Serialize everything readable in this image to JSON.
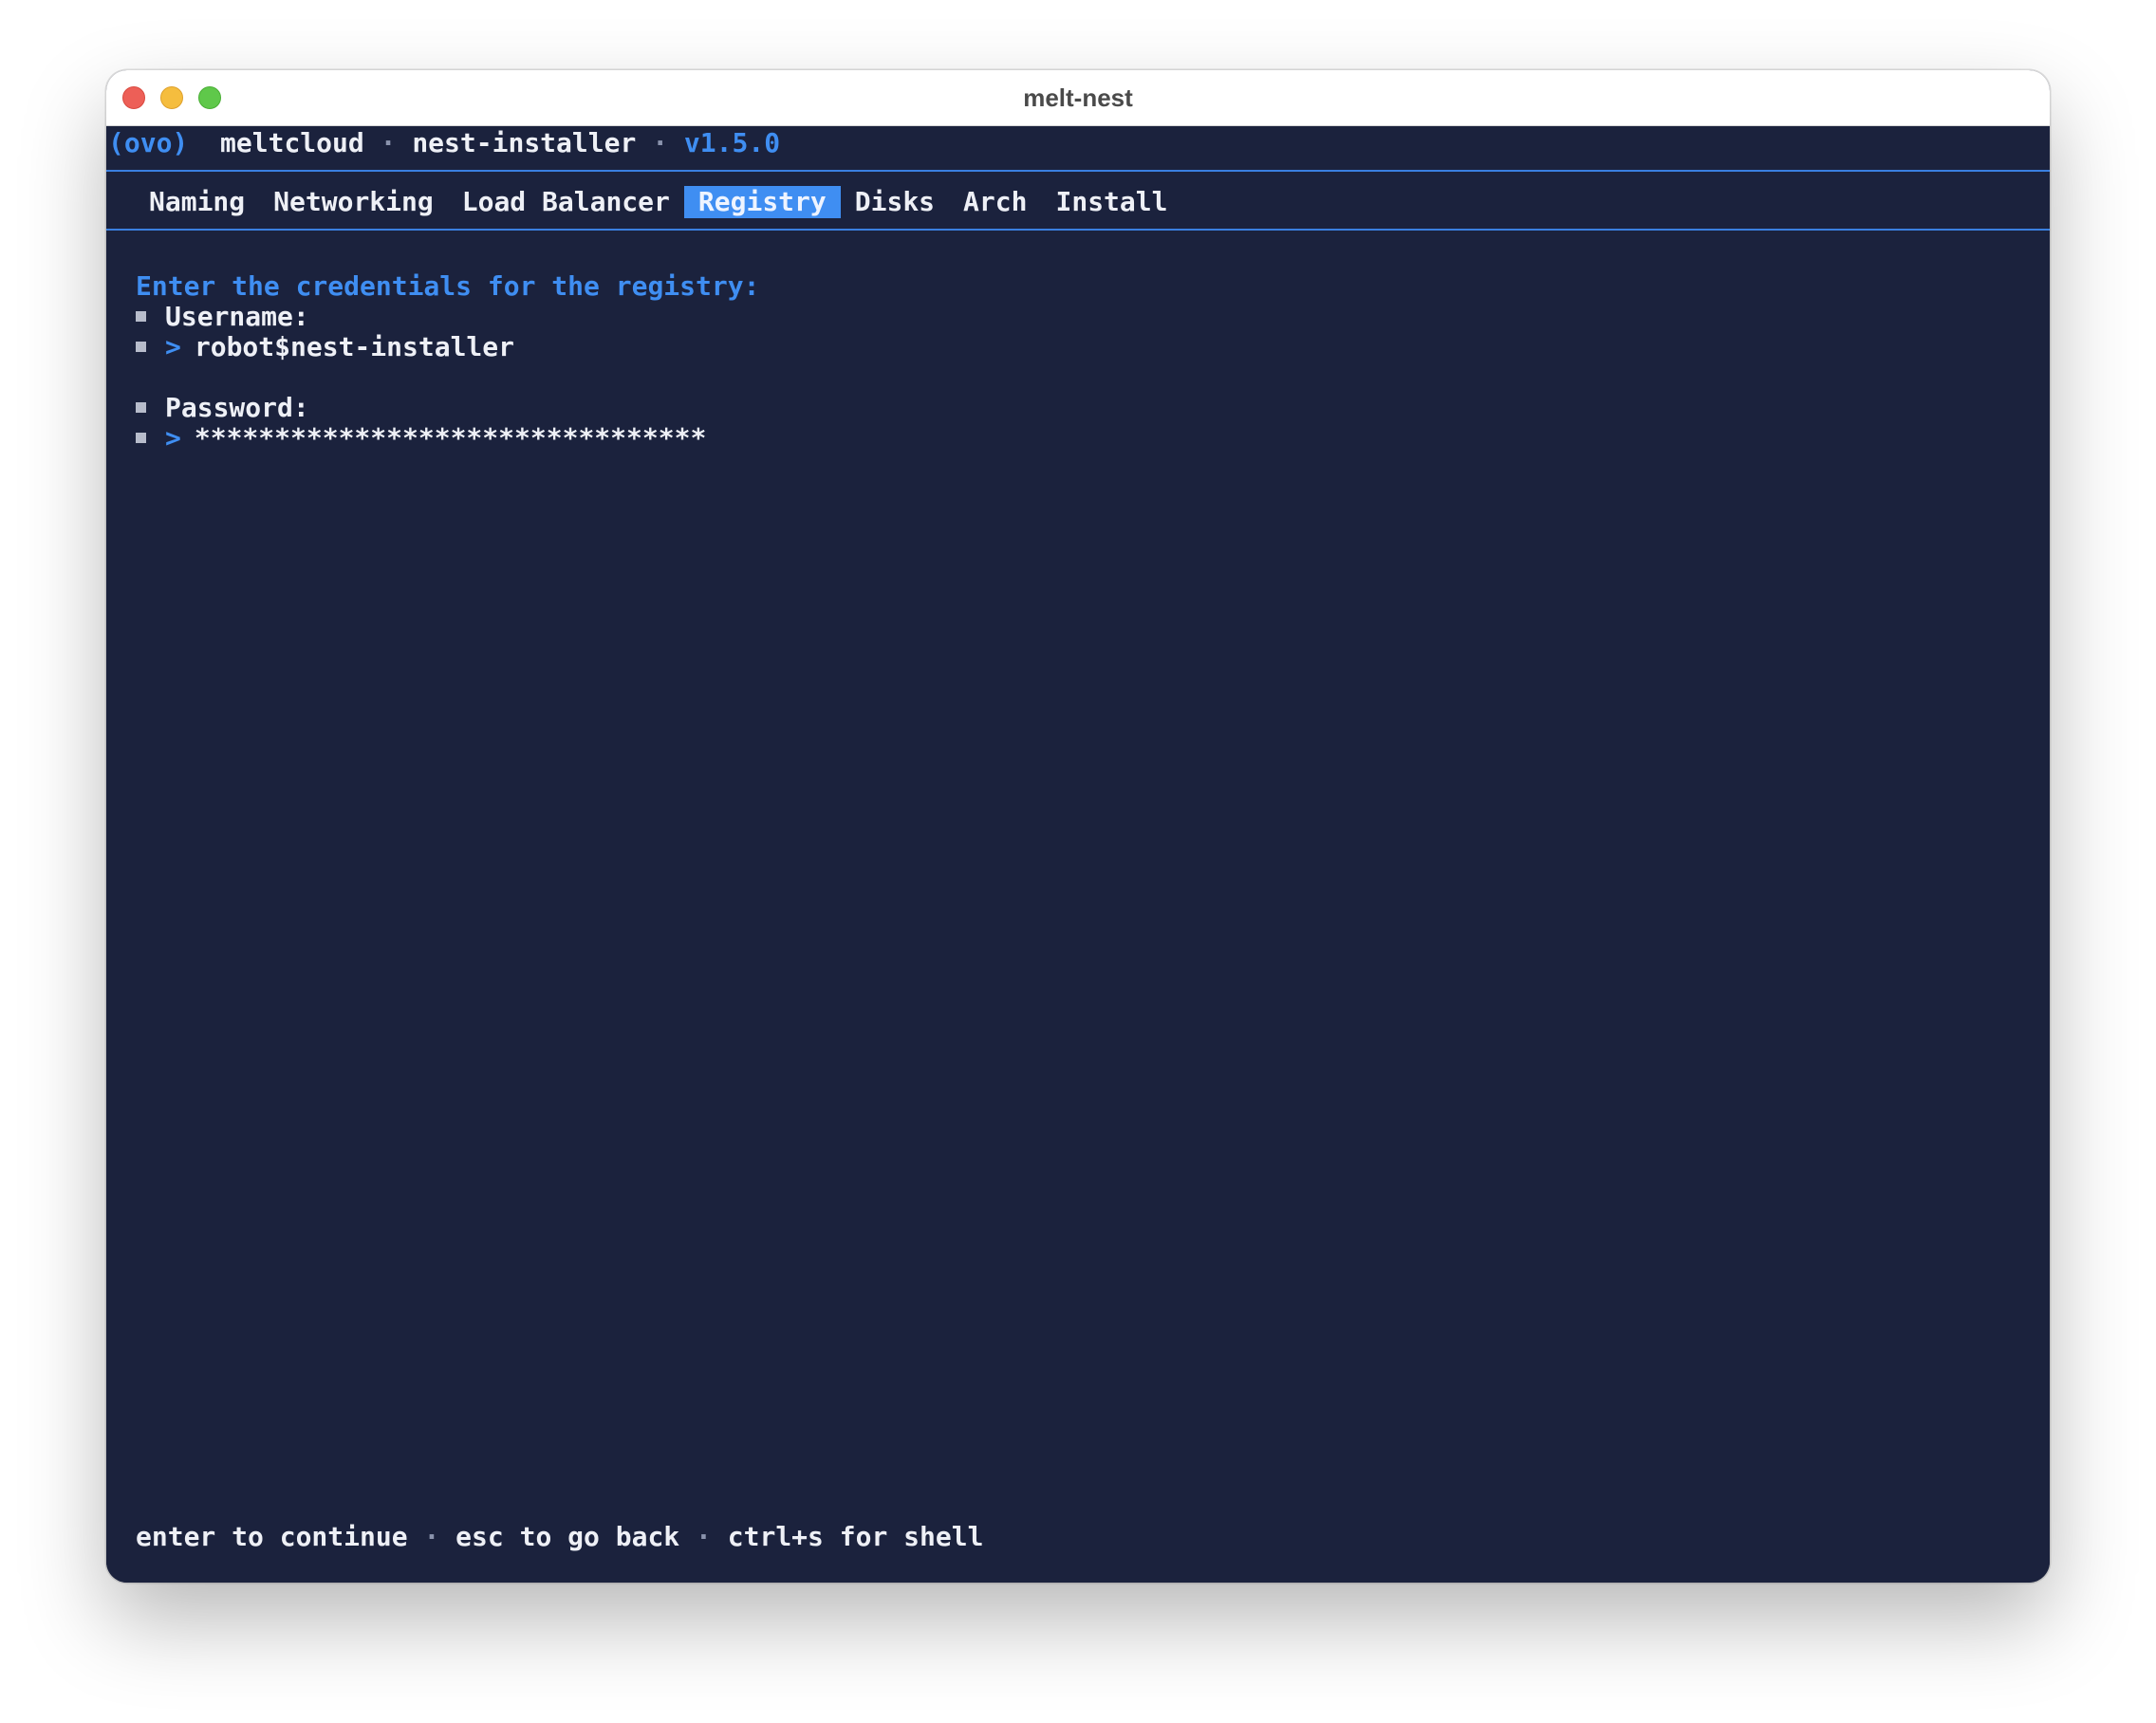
{
  "window": {
    "title": "melt-nest"
  },
  "header": {
    "logo": "(ovo)",
    "org": "meltcloud",
    "sep1": "·",
    "app": "nest-installer",
    "sep2": "·",
    "version": "v1.5.0"
  },
  "tabs": [
    {
      "label": "Naming",
      "active": false
    },
    {
      "label": "Networking",
      "active": false
    },
    {
      "label": "Load Balancer",
      "active": false
    },
    {
      "label": "Registry",
      "active": true
    },
    {
      "label": "Disks",
      "active": false
    },
    {
      "label": "Arch",
      "active": false
    },
    {
      "label": "Install",
      "active": false
    }
  ],
  "form": {
    "heading": "Enter the credentials for the registry:",
    "prompt_symbol": ">",
    "username_label": "Username:",
    "username_value": "robot$nest-installer",
    "password_label": "Password:",
    "password_value": "********************************"
  },
  "footer": {
    "hint_continue": "enter to continue",
    "sep1": "·",
    "hint_back": "esc to go back",
    "sep2": "·",
    "hint_shell": "ctrl+s for shell"
  },
  "colors": {
    "background": "#1b223d",
    "accent": "#3f8ef2",
    "text": "#eef0f6"
  }
}
